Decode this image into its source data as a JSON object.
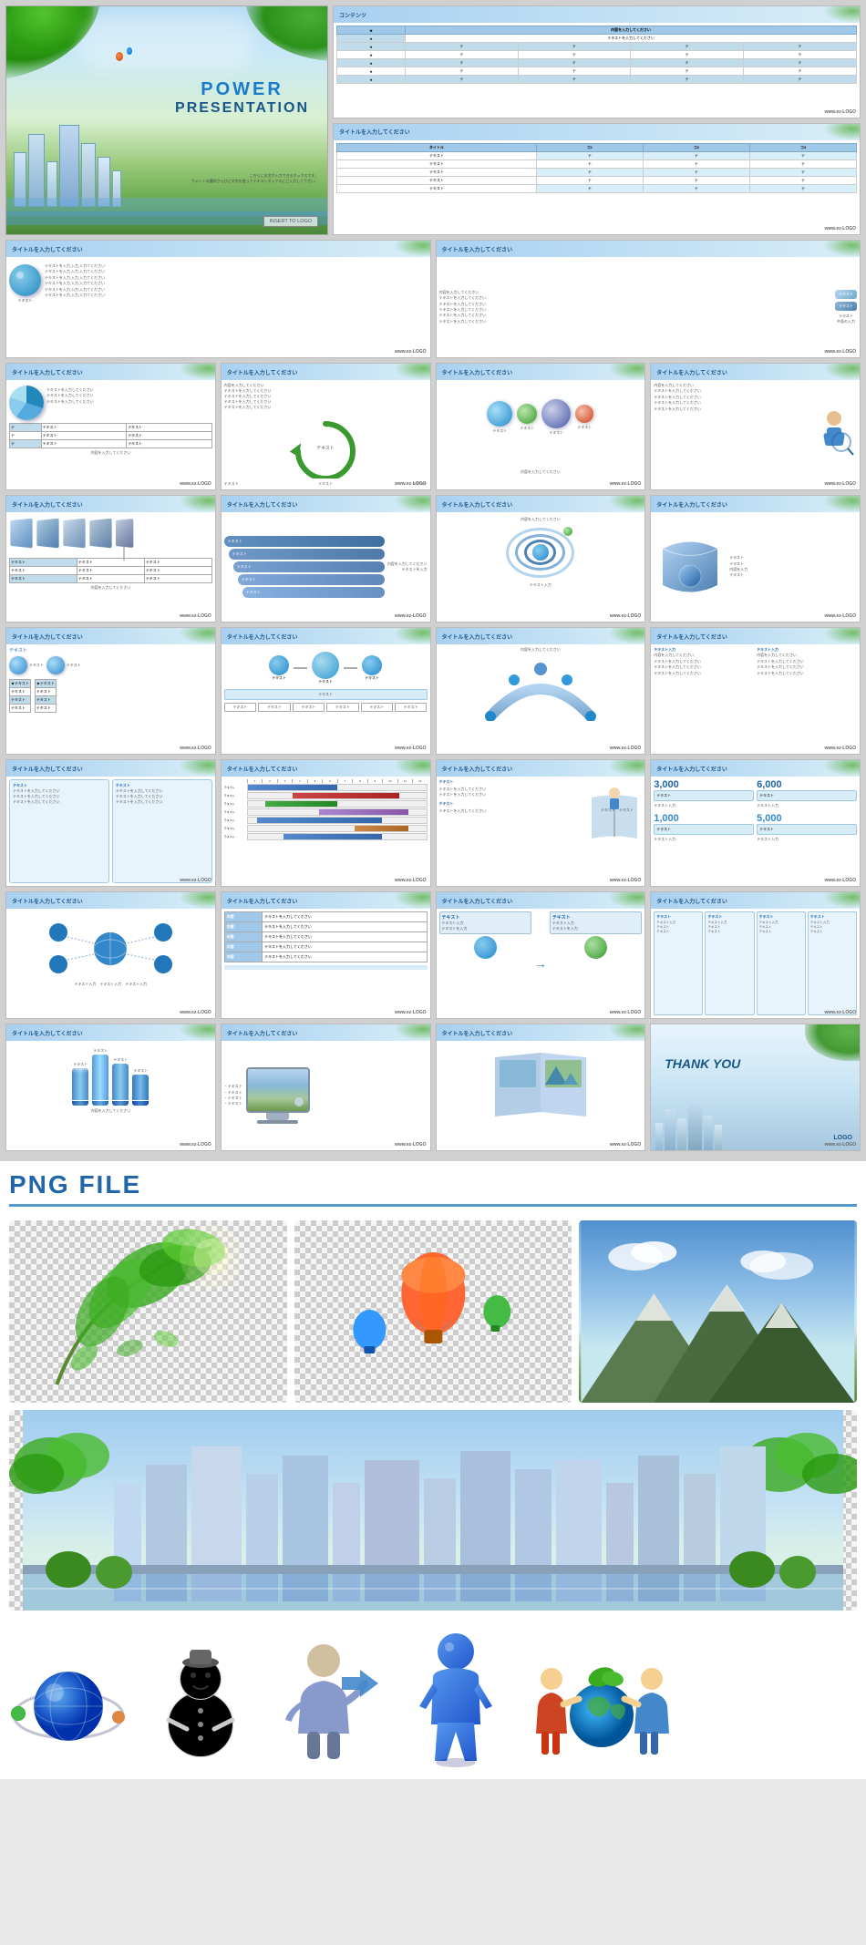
{
  "slides_section": {
    "big_slide": {
      "title_power": "POWER",
      "title_presentation": "PRESENTATION",
      "subtitle_line1": "こちらにお文が入力できるボックスです。",
      "subtitle_line2": "フォントの選択さらびに文字を使ってテキストボックスにご入力して下さい。",
      "logo_text": "INSERT TO\nLOGO"
    },
    "slide_header_text": "タイトルを入力してください",
    "content_title": "コンテンツ",
    "text_placeholder": "テキスト",
    "inner_content_label": "内容を入力してください",
    "watermark": "www.ez-LOGO",
    "thank_you": "THANK YOU",
    "logo_label": "LOGO"
  },
  "png_section": {
    "title": "PNG FILE",
    "items": [
      {
        "name": "leaves-illustration",
        "desc": "Green leaves watercolor"
      },
      {
        "name": "balloon-illustration",
        "desc": "Hot air balloons"
      },
      {
        "name": "mountain-photo",
        "desc": "Mountain with blue sky"
      },
      {
        "name": "city-skyline",
        "desc": "City buildings with green trees"
      },
      {
        "name": "globe-chain-icon",
        "desc": "Globe with chain links"
      },
      {
        "name": "mascot-person-icon",
        "desc": "White snowman-like mascot"
      },
      {
        "name": "blue-arrow-person-icon",
        "desc": "Blue person with arrow"
      },
      {
        "name": "blue-figure-icon",
        "desc": "3D blue human figure"
      },
      {
        "name": "earth-team-icon",
        "desc": "People holding earth globe"
      }
    ]
  }
}
